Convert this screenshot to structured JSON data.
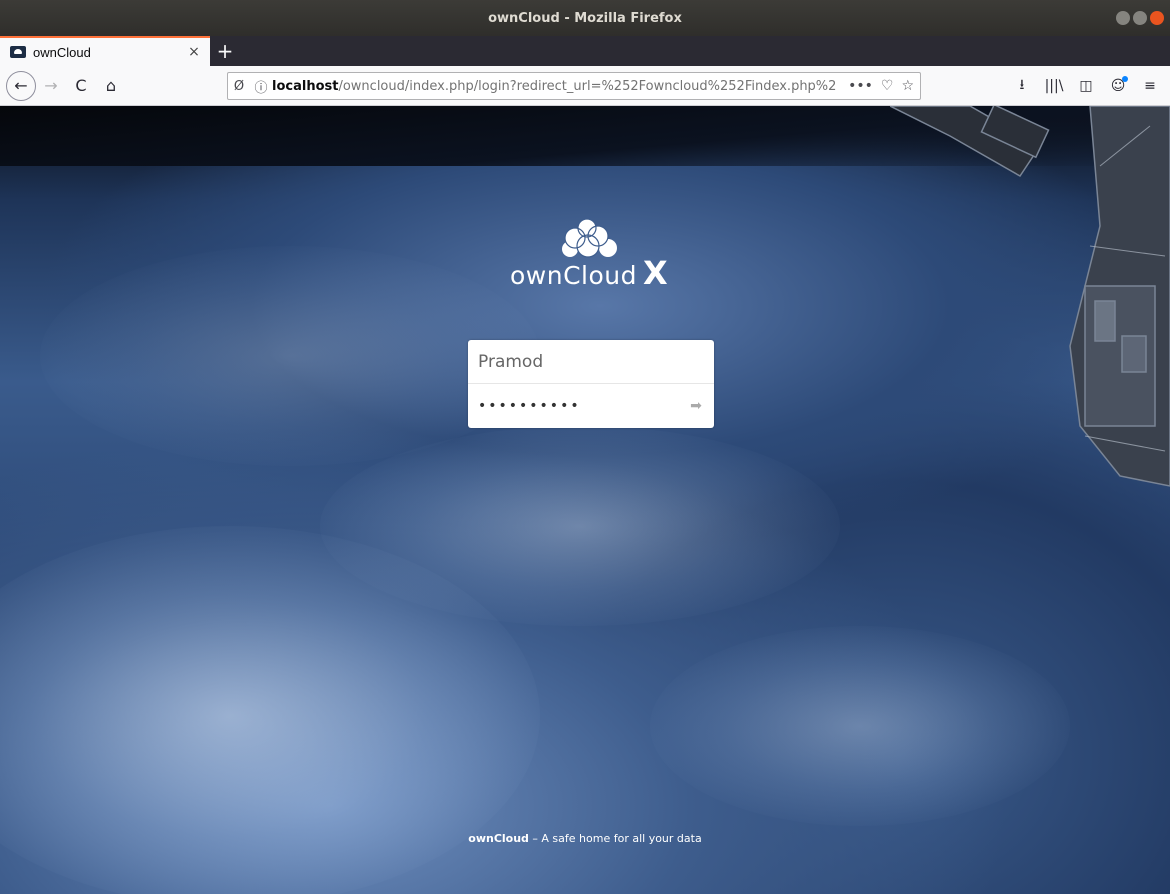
{
  "window": {
    "title": "ownCloud - Mozilla Firefox"
  },
  "tabs": [
    {
      "title": "ownCloud",
      "close": "×"
    }
  ],
  "new_tab": "+",
  "nav": {
    "back": "←",
    "forward": "→",
    "reload": "C",
    "home": "⌂",
    "url_host": "localhost",
    "url_path": "/owncloud/index.php/login?redirect_url=%252Fowncloud%252Findex.php%2",
    "url_info_icon": "ⓘ",
    "url_tracking_icon": "Ø",
    "page_actions": "•••",
    "pocket": "♡",
    "bookmark_star": "☆",
    "downloads": "⭳",
    "library": "|||\\",
    "sidebar": "◫",
    "account": "☺",
    "menu": "≡"
  },
  "brand": {
    "logo_text": "ownCloud",
    "logo_suffix": "X"
  },
  "login": {
    "username_value": "Pramod",
    "password_value": "••••••••••",
    "submit_icon": "➡"
  },
  "footer": {
    "brand": "ownCloud",
    "tagline": " – A safe home for all your data"
  },
  "colors": {
    "tab_accent": "#ff7139",
    "titlebar": "#3c3b37",
    "close_button": "#e9541f"
  }
}
